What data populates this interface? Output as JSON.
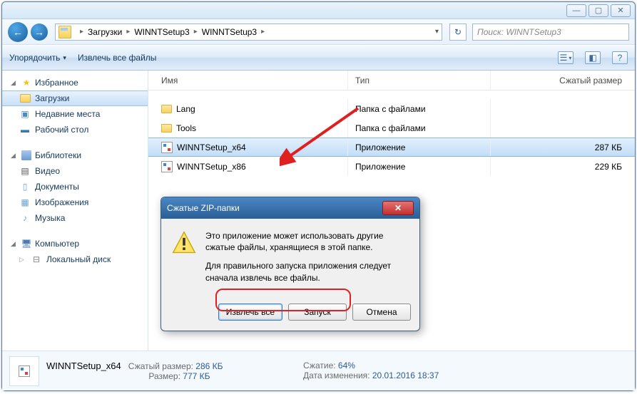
{
  "titlebar": {
    "min": "—",
    "max": "▢",
    "close": "✕"
  },
  "nav": {
    "back": "←",
    "fwd": "→",
    "refresh": "↻"
  },
  "breadcrumb": [
    "Загрузки",
    "WINNTSetup3",
    "WINNTSetup3"
  ],
  "search": {
    "placeholder": "Поиск: WINNTSetup3"
  },
  "toolbar": {
    "organize": "Упорядочить",
    "extract": "Извлечь все файлы",
    "help": "?"
  },
  "columns": {
    "name": "Имя",
    "type": "Тип",
    "size": "Сжатый размер"
  },
  "rows": [
    {
      "name": "Lang",
      "type": "Папка с файлами",
      "size": "",
      "kind": "folder"
    },
    {
      "name": "Tools",
      "type": "Папка с файлами",
      "size": "",
      "kind": "folder"
    },
    {
      "name": "WINNTSetup_x64",
      "type": "Приложение",
      "size": "287 КБ",
      "kind": "app",
      "selected": true
    },
    {
      "name": "WINNTSetup_x86",
      "type": "Приложение",
      "size": "229 КБ",
      "kind": "app"
    }
  ],
  "sidebar": {
    "favorites": {
      "label": "Избранное",
      "items": [
        "Загрузки",
        "Недавние места",
        "Рабочий стол"
      ]
    },
    "libraries": {
      "label": "Библиотеки",
      "items": [
        "Видео",
        "Документы",
        "Изображения",
        "Музыка"
      ]
    },
    "computer": {
      "label": "Компьютер",
      "items": [
        "Локальный диск"
      ]
    }
  },
  "dialog": {
    "title": "Сжатые ZIP-папки",
    "line1": "Это приложение может использовать другие сжатые файлы, хранящиеся в этой папке.",
    "line2": "Для правильного запуска приложения следует сначала извлечь все файлы.",
    "extract_all": "Извлечь все",
    "run": "Запуск",
    "cancel": "Отмена"
  },
  "details": {
    "filename": "WINNTSetup_x64",
    "compressed_label": "Сжатый размер:",
    "compressed_value": "286 КБ",
    "size_label": "Размер:",
    "size_value": "777 КБ",
    "ratio_label": "Сжатие:",
    "ratio_value": "64%",
    "modified_label": "Дата изменения:",
    "modified_value": "20.01.2016 18:37"
  }
}
